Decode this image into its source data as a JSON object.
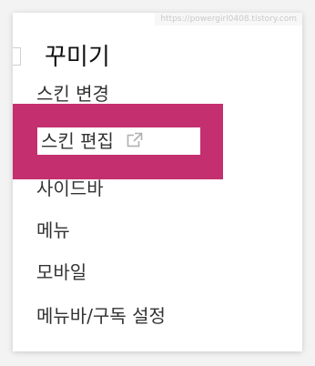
{
  "watermark": "https://powergirl0408.tistory.com",
  "section": {
    "title": "꾸미기"
  },
  "menu": {
    "skin_change": "스킨 변경",
    "skin_edit": "스킨 편집",
    "sidebar": "사이드바",
    "menu": "메뉴",
    "mobile": "모바일",
    "menubar_subscribe": "메뉴바/구독 설정"
  },
  "colors": {
    "highlight": "#c4306f",
    "text": "#333333",
    "title": "#111111"
  },
  "icons": {
    "skin_edit": "external-link-icon",
    "collapse": "collapse-tab-icon"
  }
}
